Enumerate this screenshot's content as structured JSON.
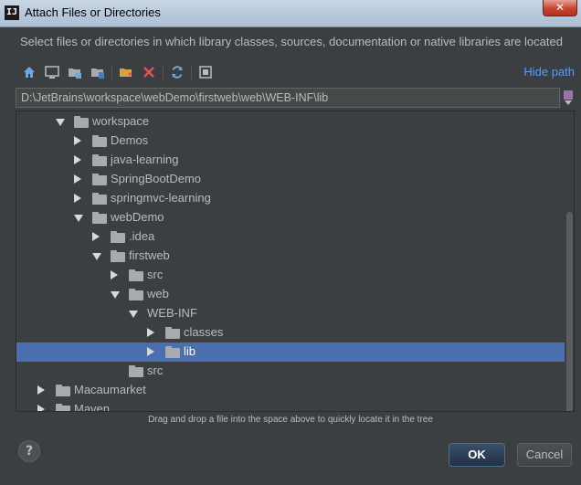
{
  "window": {
    "app_icon": "IJ",
    "title": "Attach Files or Directories",
    "close_label": "✕"
  },
  "description": "Select files or directories in which library classes, sources, documentation or native libraries are located",
  "toolbar": {
    "icons": [
      "home-icon",
      "desktop-icon",
      "project-folder-icon",
      "module-folder-icon",
      "new-folder-icon",
      "delete-icon",
      "refresh-icon",
      "show-hidden-icon"
    ],
    "hide_path_label": "Hide path"
  },
  "path_field": {
    "value": "D:\\JetBrains\\workspace\\webDemo\\firstweb\\web\\WEB-INF\\lib"
  },
  "tree": {
    "rows": [
      {
        "label": "workspace",
        "level": 0,
        "state": "expanded",
        "selected": false
      },
      {
        "label": "Demos",
        "level": 1,
        "state": "collapsed",
        "selected": false
      },
      {
        "label": "java-learning",
        "level": 1,
        "state": "collapsed",
        "selected": false
      },
      {
        "label": "SpringBootDemo",
        "level": 1,
        "state": "collapsed",
        "selected": false
      },
      {
        "label": "springmvc-learning",
        "level": 1,
        "state": "collapsed",
        "selected": false
      },
      {
        "label": "webDemo",
        "level": 1,
        "state": "expanded",
        "selected": false
      },
      {
        "label": ".idea",
        "level": 2,
        "state": "collapsed",
        "selected": false
      },
      {
        "label": "firstweb",
        "level": 2,
        "state": "expanded",
        "selected": false
      },
      {
        "label": "src",
        "level": 3,
        "state": "collapsed",
        "selected": false
      },
      {
        "label": "web",
        "level": 3,
        "state": "expanded",
        "selected": false
      },
      {
        "label": "WEB-INF",
        "level": 4,
        "state": "expanded",
        "selected": false,
        "no_folder": true
      },
      {
        "label": "classes",
        "level": 5,
        "state": "collapsed",
        "selected": false
      },
      {
        "label": "lib",
        "level": 5,
        "state": "collapsed",
        "selected": true
      },
      {
        "label": "src",
        "level": 3,
        "state": "none",
        "selected": false
      },
      {
        "label": "Macaumarket",
        "level": -1,
        "state": "collapsed",
        "selected": false
      },
      {
        "label": "Maven",
        "level": -1,
        "state": "collapsed",
        "selected": false
      }
    ]
  },
  "hint": "Drag and drop a file into the space above to quickly locate it in the tree",
  "buttons": {
    "help_label": "?",
    "ok_label": "OK",
    "cancel_label": "Cancel"
  },
  "colors": {
    "background": "#3c3f41",
    "selection": "#4b6eaf",
    "link": "#589df6"
  }
}
